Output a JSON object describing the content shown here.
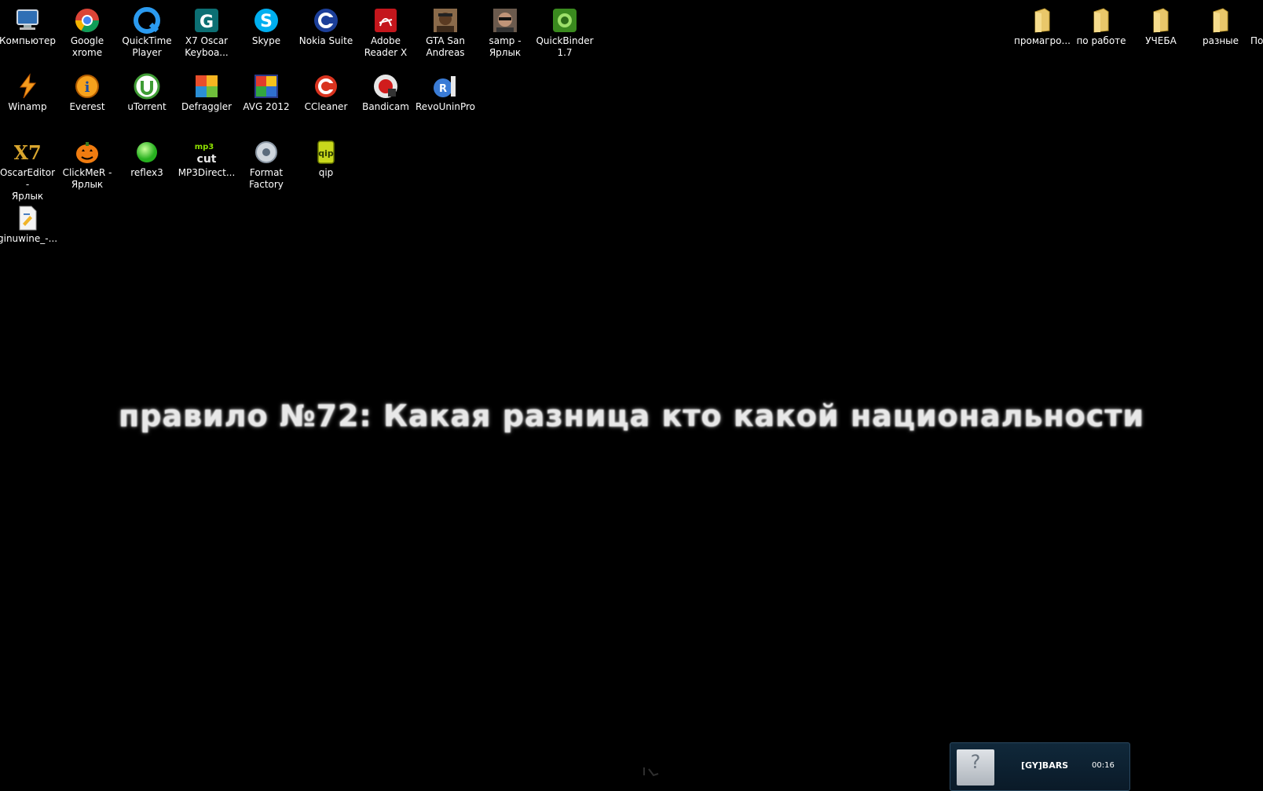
{
  "desktop": {
    "icons": [
      {
        "label": "Компьютер",
        "icon": "computer-icon"
      },
      {
        "label": "Google\nxrome",
        "icon": "chrome-icon"
      },
      {
        "label": "QuickTime\nPlayer",
        "icon": "quicktime-icon"
      },
      {
        "label": "X7 Oscar\nKeyboa...",
        "icon": "x7-oscar-icon"
      },
      {
        "label": "Skype",
        "icon": "skype-icon"
      },
      {
        "label": "Nokia Suite",
        "icon": "nokia-suite-icon"
      },
      {
        "label": "Adobe\nReader X",
        "icon": "adobe-reader-icon"
      },
      {
        "label": "GTA San\nAndreas",
        "icon": "gta-icon"
      },
      {
        "label": "samp -\nЯрлык",
        "icon": "samp-icon"
      },
      {
        "label": "QuickBinder\n1.7",
        "icon": "quickbinder-icon"
      },
      {
        "label": "Winamp",
        "icon": "winamp-icon"
      },
      {
        "label": "Everest",
        "icon": "everest-icon"
      },
      {
        "label": "uTorrent",
        "icon": "utorrent-icon"
      },
      {
        "label": "Defraggler",
        "icon": "defraggler-icon"
      },
      {
        "label": "AVG 2012",
        "icon": "avg-icon"
      },
      {
        "label": "CCleaner",
        "icon": "ccleaner-icon"
      },
      {
        "label": "Bandicam",
        "icon": "bandicam-icon"
      },
      {
        "label": "RevoUninPro",
        "icon": "revo-icon"
      },
      {
        "label": "OscarEditor -\nЯрлык",
        "icon": "oscareditor-icon"
      },
      {
        "label": "ClickMeR -\nЯрлык",
        "icon": "clickmer-icon"
      },
      {
        "label": "reflex3",
        "icon": "reflex-icon"
      },
      {
        "label": "MP3Direct...",
        "icon": "mp3directcut-icon"
      },
      {
        "label": "Format\nFactory",
        "icon": "format-factory-icon"
      },
      {
        "label": "qip",
        "icon": "qip-icon"
      },
      {
        "label": "ginuwine_-...",
        "icon": "file-icon"
      }
    ],
    "folders": [
      {
        "label": "промагро..."
      },
      {
        "label": "по работе"
      },
      {
        "label": "УЧЕБА"
      },
      {
        "label": "разные"
      },
      {
        "label": "По"
      }
    ]
  },
  "overlay": {
    "text": "правило №72: Какая разница кто какой национальности"
  },
  "notification": {
    "avatar_glyph": "?",
    "nick": "[GY]BARS",
    "time": "00:16"
  }
}
